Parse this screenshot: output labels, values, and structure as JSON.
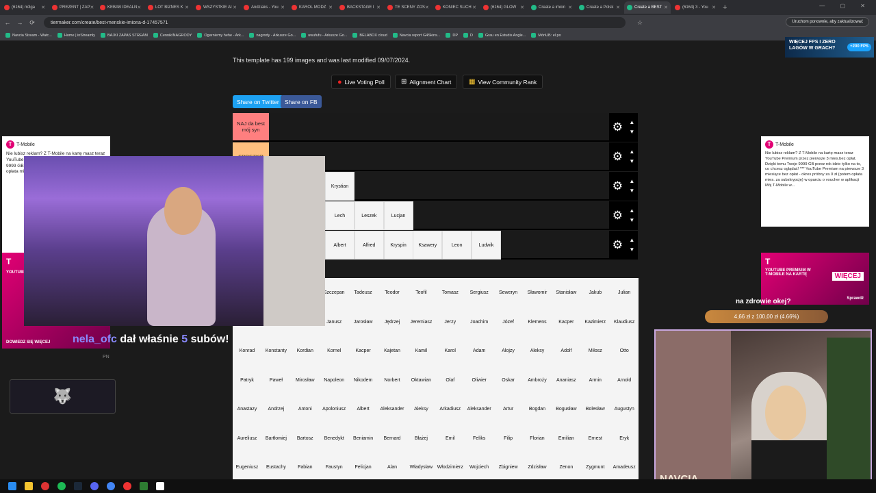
{
  "browser": {
    "tabs": [
      {
        "label": "(6164) m3ga"
      },
      {
        "label": "PREZENT | ZAP"
      },
      {
        "label": "KEBAB IDEALN"
      },
      {
        "label": "LOT BIZNES K"
      },
      {
        "label": "WSZYSTKIE AI"
      },
      {
        "label": "Andziaks - You"
      },
      {
        "label": "KAROL MODZ"
      },
      {
        "label": "BACKSTAGE I"
      },
      {
        "label": "TE SCENY ZOS"
      },
      {
        "label": "KONIEC SUCH"
      },
      {
        "label": "(6164) GLOW"
      },
      {
        "label": "Create a imion"
      },
      {
        "label": "Create a Polsk"
      },
      {
        "label": "Create a BEST"
      },
      {
        "label": "(6164) 3 - You"
      }
    ],
    "url": "tiermaker.com/create/best-menskie-imiona-d-17457571",
    "restart_label": "Uruchom ponownie, aby zaktualizować",
    "bookmarks": [
      "Navcia Stream - Watc...",
      "Home | inStreamly",
      "BAJKI ZAPAS STREAM",
      "Cennik/NAGRODY",
      "Ogarniemy hehe - Ark...",
      "nagrody - Arkusze Go...",
      "uwufufu - Arkusze Go...",
      "BELABOX cloud",
      "Navcia report G4Skins...",
      "DP",
      "D",
      "Grau en Estudis Angle...",
      "MónUB: el po"
    ]
  },
  "page": {
    "info_text": "This template has 199 images and was last modified 09/07/2024.",
    "buttons": {
      "live_voting": "Live Voting Poll",
      "alignment": "Alignment Chart",
      "community": "View Community Rank",
      "share_twitter": "Share on Twitter",
      "share_fb": "Share on FB"
    },
    "tiers": [
      {
        "label": "NAJ da best mój syn",
        "color": "#ff7f7f",
        "items": []
      },
      {
        "label": "SPOCZKO",
        "color": "#ffbf7f",
        "items": []
      },
      {
        "label": "",
        "color": "#ffdf7f",
        "items": [
          "Krystian"
        ]
      },
      {
        "label": "",
        "color": "#ffff7f",
        "items": [
          "Lech",
          "Leszek",
          "Lucjan"
        ]
      },
      {
        "label": "",
        "color": "#bfff7f",
        "items": [
          "Albert",
          "Alfred",
          "Kryspin",
          "Ksawery",
          "Leon",
          "Ludwik"
        ]
      }
    ],
    "pool": [
      [
        "Szczepan",
        "Tadeusz",
        "Teodor",
        "Teofil",
        "Tomasz",
        "Sergiusz",
        "Seweryn",
        "Sławomir",
        "Stanisław",
        "Jakub",
        "Julian"
      ],
      [
        "Janusz",
        "Jarosław",
        "Jędrzej",
        "Jeremiasz",
        "Jerzy",
        "Joachim",
        "Józef",
        "Klemens",
        "Kacper",
        "Kazimierz",
        "Klaudiusz"
      ],
      [
        "Konrad",
        "Konstanty",
        "Kordian",
        "Kornel",
        "Kacper",
        "Kajetan",
        "Kamil",
        "Karol",
        "Adam",
        "Alojzy",
        "Aleksy",
        "Adolf",
        "Miłosz",
        "Otto"
      ],
      [
        "Patryk",
        "Paweł",
        "Mirosław",
        "Napoleon",
        "Nikodem",
        "Norbert",
        "Oktawian",
        "Olaf",
        "Oliwier",
        "Oskar",
        "Ambroży",
        "Ananiasz",
        "Armin",
        "Arnold"
      ],
      [
        "Anastazy",
        "Andrzej",
        "Antoni",
        "Apoloniusz",
        "Albert",
        "Aleksander",
        "Aleksy",
        "Arkadiusz",
        "Aleksander",
        "Artur",
        "Bogdan",
        "Bogusław",
        "Bolesław",
        "Augustyn"
      ],
      [
        "Aureliusz",
        "Bartłomiej",
        "Bartosz",
        "Benedykt",
        "Beniamin",
        "Bernard",
        "Błażej",
        "Emil",
        "Feliks",
        "Filip",
        "Florian",
        "Emilian",
        "Ernest",
        "Eryk"
      ],
      [
        "Eugeniusz",
        "Eustachy",
        "Fabian",
        "Faustyn",
        "Felicjan",
        "Alan",
        "Władysław",
        "Włodzimierz",
        "Wojciech",
        "Zbigniew",
        "Zdzisław",
        "Zenon",
        "Zygmunt",
        "Amadeusz"
      ]
    ]
  },
  "overlay": {
    "ad_left_brand": "T-Mobile",
    "ad_left_text": "Nie lubisz reklam? Z T-Mobile na kartę masz teraz YouTube Premium przez pierwsze 3 mies. Twoje 9999 GB co chcesz oglądać! YouTube bez opłat opłata mies. voucher",
    "ad_left_banner": "YOUTUBE PREMIUM W T-MOBILE NA KARTĘ",
    "ad_left_cta": "DOWIEDZ SIĘ WIĘCEJ",
    "ad_right_brand": "T-Mobile",
    "ad_right_text": "Nie lubisz reklam? Z T-Mobile na kartę masz teraz YouTube Premium przez pierwsze 3 mies.bez opłat. Dzięki temu Twoje 9999 GB przez rok idzie tylko na to, co chcesz oglądać! *** YouTube Premium na pierwsze 3 miesiące bez opłat - okres próbny za 0 zł (potem opłata mies. za subskrypcję) w oparciu o voucher w aplikacji Mój T-Mobile w...",
    "ad_right_banner": "YOUTUBE PREMIUM W T-MOBILE NA KARTĘ",
    "ad_right_cta": "Sprawdź",
    "ad_right_more": "WIĘCEJ",
    "promo_banner": "WIĘCEJ FPS I ZERO LAGÓW W GRACH?",
    "promo_badge": "+200 FPS",
    "sub_alert_user": "nela_ofc",
    "sub_alert_text": "dał właśnie",
    "sub_alert_count": "5",
    "sub_alert_suffix": "subów!",
    "goal_title": "na zdrowie okej?",
    "goal_progress": "4,66 zł z 100,00 zł (4.66%)",
    "goal_fraction": 0.0466,
    "streamer_name": "NAVCIA",
    "small_label": "PN"
  }
}
